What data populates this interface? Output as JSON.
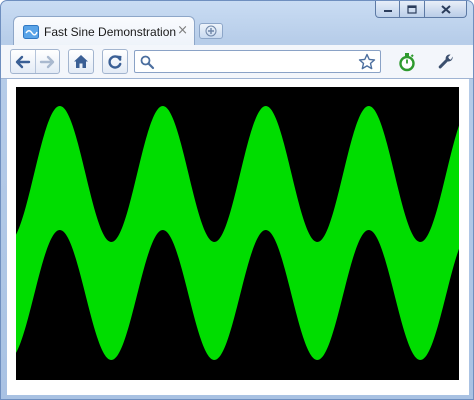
{
  "window": {
    "caption_buttons": [
      "minimize-icon",
      "maximize-icon",
      "close-icon"
    ]
  },
  "tab": {
    "title": "Fast Sine Demonstration",
    "favicon": "page-icon",
    "close_glyph": "×"
  },
  "toolbar": {
    "back_icon": "back-arrow-icon",
    "forward_icon": "forward-arrow-icon",
    "home_icon": "home-icon",
    "reload_icon": "reload-icon",
    "omnibox": {
      "value": "",
      "placeholder": "",
      "search_icon": "search-icon",
      "bookmark_icon": "star-icon"
    },
    "extension_icon": "stopwatch-icon",
    "menu_icon": "wrench-icon"
  },
  "content": {
    "canvas_background": "#000000",
    "wave_color": "#00dd00"
  },
  "colors": {
    "frame": "#b7cde9",
    "wave": "#00dd00",
    "canvas": "#000000"
  }
}
